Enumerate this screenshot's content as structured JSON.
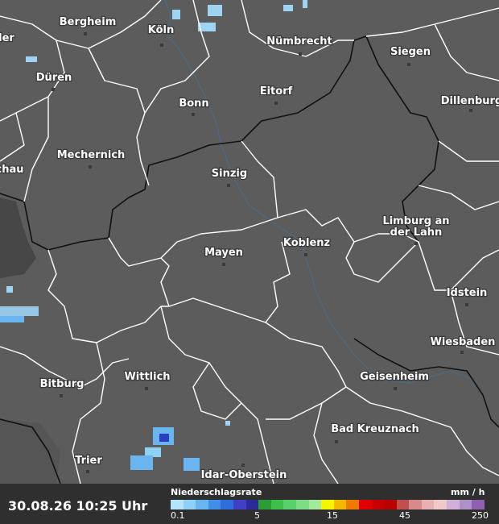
{
  "map": {
    "cities": [
      {
        "name": "Bergheim"
      },
      {
        "name": "Köln"
      },
      {
        "name": "Nümbrecht"
      },
      {
        "name": "Siegen"
      },
      {
        "name": "Düren"
      },
      {
        "name": "Bonn"
      },
      {
        "name": "Eitorf"
      },
      {
        "name": "Dillenburg"
      },
      {
        "name": "Mechernich"
      },
      {
        "name": "Sinzig"
      },
      {
        "name": "Limburg an"
      },
      {
        "name": "der Lahn"
      },
      {
        "name": "Koblenz"
      },
      {
        "name": "Mayen"
      },
      {
        "name": "Idstein"
      },
      {
        "name": "Wiesbaden"
      },
      {
        "name": "Bitburg"
      },
      {
        "name": "Wittlich"
      },
      {
        "name": "Geisenheim"
      },
      {
        "name": "Bad Kreuznach"
      },
      {
        "name": "Trier"
      },
      {
        "name": "Idar-Oberstein"
      },
      {
        "name": "ler"
      },
      {
        "name": "chau"
      }
    ],
    "background_color": "#5c5c5c",
    "precip_color_light": "#9fd3f2",
    "precip_color_mid": "#4f8fe0",
    "precip_color_dark": "#2a3fc0"
  },
  "footer": {
    "timestamp": "30.08.26 10:25 Uhr",
    "legend_title": "Niederschlagsrate",
    "legend_unit": "mm / h",
    "ticks": [
      "0.1",
      "5",
      "15",
      "45",
      "250"
    ],
    "scale_colors": [
      "#b4e4fb",
      "#8fd0f5",
      "#6ab4ef",
      "#3f8fe6",
      "#2f6ddc",
      "#3f3fc7",
      "#2d2a9a",
      "#2e9c34",
      "#3cc04a",
      "#5ad06a",
      "#7ddc85",
      "#a4ea9d",
      "#f5f500",
      "#f5b800",
      "#f07a00",
      "#e00000",
      "#c80000",
      "#b80000",
      "#c05050",
      "#d88a8a",
      "#e8b0b0",
      "#f0c8c8",
      "#d0b0d8",
      "#b090c8",
      "#9060b0"
    ]
  }
}
